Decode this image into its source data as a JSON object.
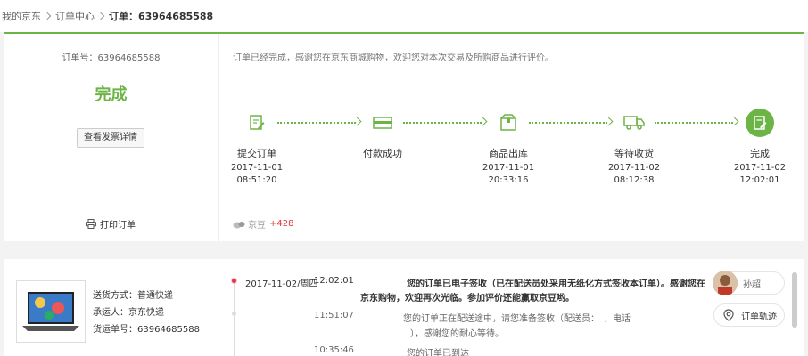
{
  "breadcrumb": {
    "items": [
      "我的京东",
      "订单中心"
    ],
    "current": "订单：63964685588"
  },
  "summary": {
    "order_no": "订单号：63964685588",
    "status": "完成",
    "invoice_button": "查看发票详情",
    "print_label": "打印订单"
  },
  "notice": "订单已经完成，感谢您在京东商城购物，欢迎您对本次交易及所购商品进行评价。",
  "bean": {
    "label": "京豆",
    "value": "+428"
  },
  "steps": [
    {
      "name": "提交订单",
      "date": "2017-11-01",
      "time": "08:51:20",
      "icon": "edit-doc-icon"
    },
    {
      "name": "付款成功",
      "date": "",
      "time": "",
      "icon": "card-icon"
    },
    {
      "name": "商品出库",
      "date": "2017-11-01",
      "time": "20:33:16",
      "icon": "box-icon"
    },
    {
      "name": "等待收货",
      "date": "2017-11-02",
      "time": "08:12:38",
      "icon": "truck-icon"
    },
    {
      "name": "完成",
      "date": "2017-11-02",
      "time": "12:02:01",
      "icon": "check-doc-icon"
    }
  ],
  "shipping": {
    "method": "送货方式：普通快递",
    "carrier": "承运人：京东快递",
    "tracking": "货运单号：63964685588"
  },
  "tracking": [
    {
      "date": "2017-11-02/周四",
      "time": "12:02:01",
      "text1": "您的订单已电子签收（已在配送员处采用无纸化方式签收本订单）。感谢您在",
      "text2": "京东购物，欢迎再次光临。参加评价还能赢取京豆哟。"
    },
    {
      "time": "11:51:07",
      "text1": "您的订单正在配送途中，请您准备签收（配送员：",
      "text1b": "，电话",
      "text2": "），感谢您的耐心等待。"
    },
    {
      "time": "10:35:46",
      "text1": "您的订单已到达"
    }
  ],
  "side": {
    "courier_name": "孙超",
    "track_button": "订单轨迹"
  },
  "colors": {
    "accent": "#6db446",
    "red": "#e4393c"
  }
}
